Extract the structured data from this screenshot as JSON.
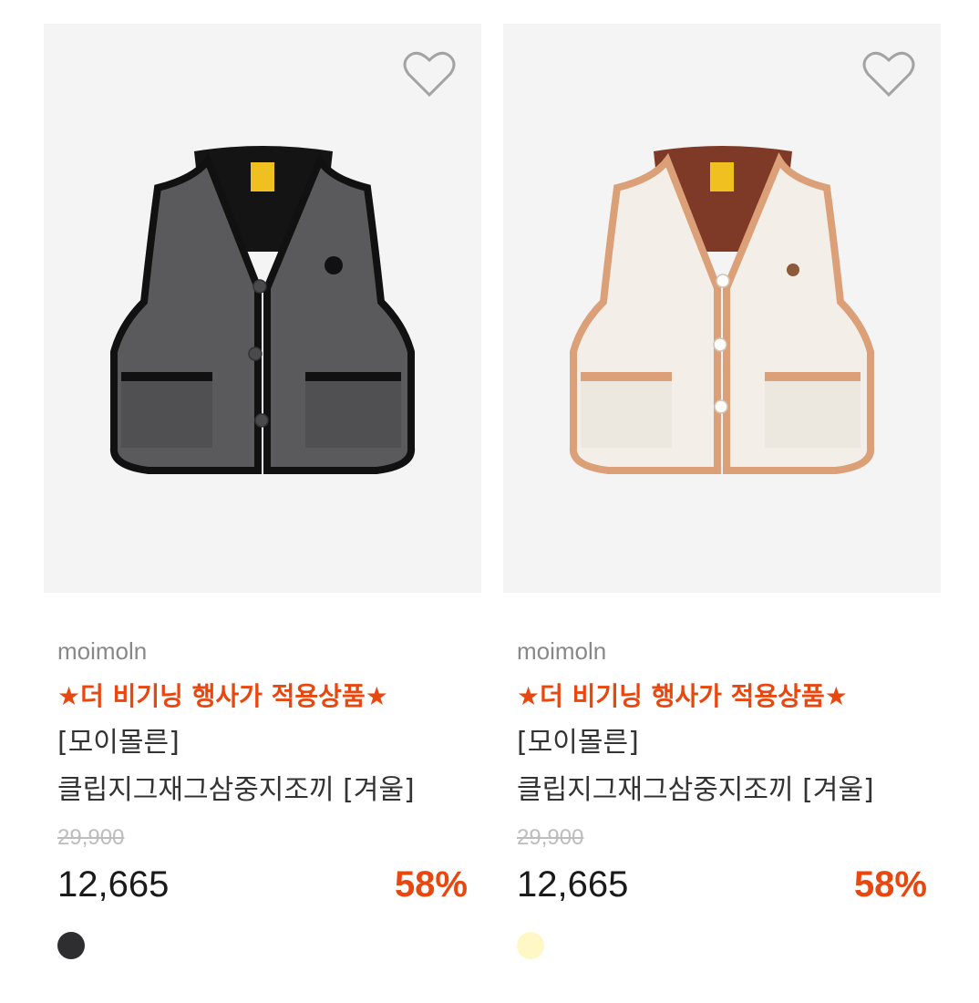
{
  "products": [
    {
      "brand": "moimoln",
      "event_label": "★더 비기닝 행사가 적용상품★",
      "name_line1": "[모이몰른]",
      "name_line2": "클립지그재그삼중지조끼 [겨울]",
      "original_price": "29,900",
      "sale_price": "12,665",
      "discount": "58%",
      "swatch_color": "#2e2e30",
      "wishlist_icon": "heart-outline-icon",
      "vest_colors": {
        "body": "#5a5a5c",
        "trim": "#111111",
        "lining": "#141414"
      }
    },
    {
      "brand": "moimoln",
      "event_label": "★더 비기닝 행사가 적용상품★",
      "name_line1": "[모이몰른]",
      "name_line2": "클립지그재그삼중지조끼 [겨울]",
      "original_price": "29,900",
      "sale_price": "12,665",
      "discount": "58%",
      "swatch_color": "#fff8c6",
      "wishlist_icon": "heart-outline-icon",
      "vest_colors": {
        "body": "#f3efe8",
        "trim": "#dca078",
        "lining": "#7e3a26"
      }
    }
  ]
}
